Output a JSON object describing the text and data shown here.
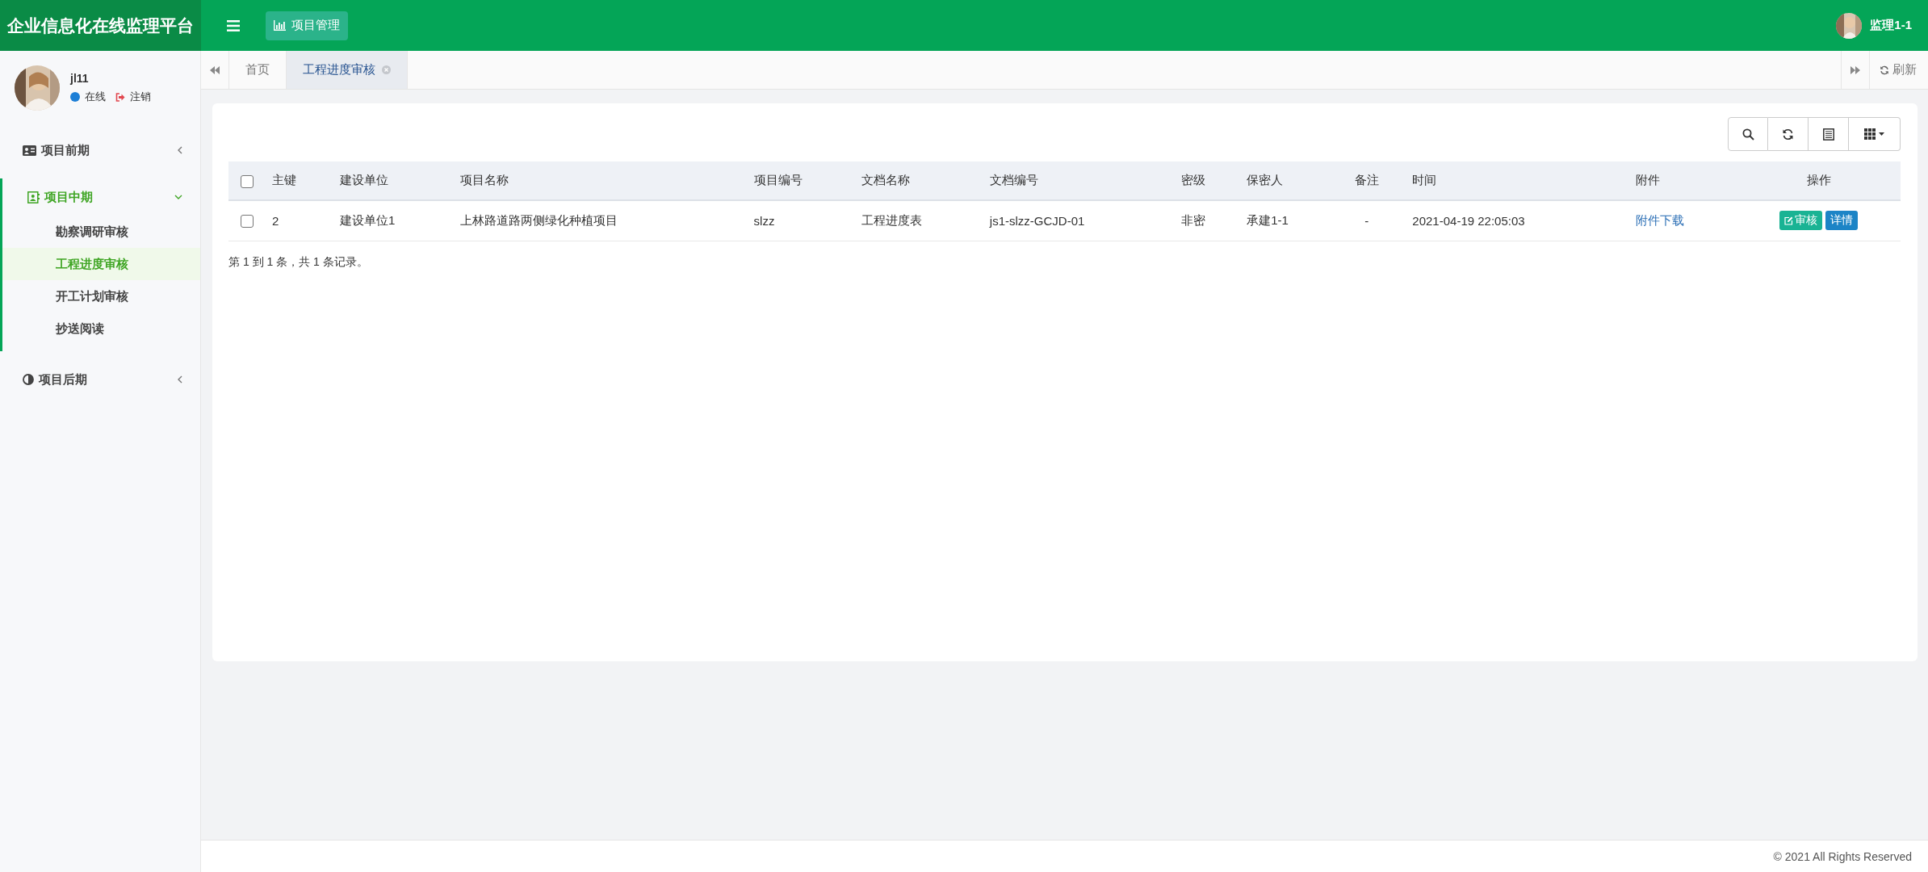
{
  "header": {
    "title": "企业信息化在线监理平台",
    "nav_button": "项目管理",
    "user": "监理1-1"
  },
  "sidebar": {
    "user": {
      "name": "jl11",
      "status": "在线",
      "online": true,
      "logout": "注销"
    },
    "menu": [
      {
        "label": "项目前期",
        "expanded": false
      },
      {
        "label": "项目中期",
        "expanded": true,
        "children": [
          {
            "label": "勘察调研审核",
            "selected": false
          },
          {
            "label": "工程进度审核",
            "selected": true
          },
          {
            "label": "开工计划审核",
            "selected": false
          },
          {
            "label": "抄送阅读",
            "selected": false
          }
        ]
      },
      {
        "label": "项目后期",
        "expanded": false
      }
    ]
  },
  "tabs": [
    {
      "label": "首页",
      "selected": false,
      "closable": false
    },
    {
      "label": "工程进度审核",
      "selected": true,
      "closable": true
    }
  ],
  "refresh": "刷新",
  "table": {
    "columns": [
      "主键",
      "建设单位",
      "项目名称",
      "项目编号",
      "文档名称",
      "文档编号",
      "密级",
      "保密人",
      "备注",
      "时间",
      "附件",
      "操作"
    ],
    "rows": [
      {
        "checked": false,
        "cells": [
          "2",
          "建设单位1",
          "上林路道路两侧绿化种植项目",
          "slzz",
          "工程进度表",
          "js1-slzz-GCJD-01",
          "非密",
          "承建1-1",
          "-",
          "2021-04-19 22:05:03"
        ],
        "attachment": "附件下载",
        "actions": [
          {
            "kind": "review",
            "label": "审核"
          },
          {
            "kind": "detail",
            "label": "详情"
          }
        ]
      }
    ],
    "all_checked": false,
    "pagination": "第 1 到 1 条，共 1 条记录。"
  },
  "footer": "© 2021 All Rights Reserved"
}
